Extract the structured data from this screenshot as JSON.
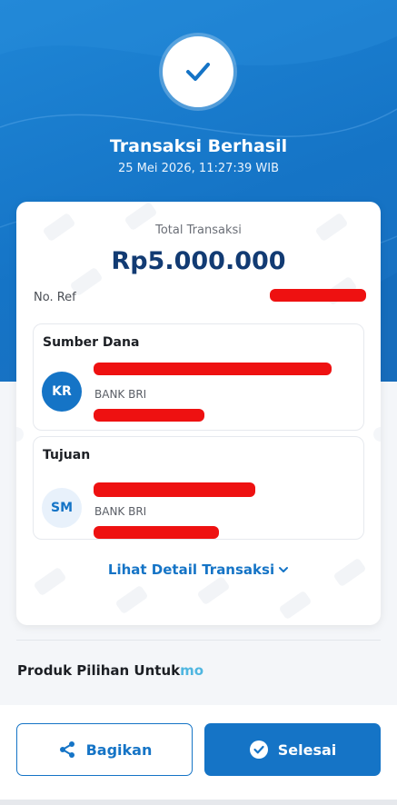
{
  "status": {
    "title": "Transaksi Berhasil",
    "datetime": "25 Mei 2026, 11:27:39 WIB"
  },
  "summary": {
    "total_label": "Total Transaksi",
    "total_amount": "Rp5.000.000",
    "ref_label": "No. Ref"
  },
  "source": {
    "title": "Sumber Dana",
    "initials": "KR",
    "bank": "BANK BRI"
  },
  "destination": {
    "title": "Tujuan",
    "initials": "SM",
    "bank": "BANK BRI"
  },
  "detail_link": "Lihat Detail Transaksi",
  "products": {
    "title": "Produk Pilihan Untuk",
    "brand": "mo"
  },
  "actions": {
    "share_label": "Bagikan",
    "done_label": "Selesai"
  },
  "colors": {
    "primary": "#1574c6",
    "amount": "#123b73",
    "redaction": "#ee1111",
    "brand_accent": "#4fb6e0"
  },
  "icons": [
    "check-icon",
    "chevron-down-icon",
    "share-icon",
    "check-circle-icon"
  ]
}
